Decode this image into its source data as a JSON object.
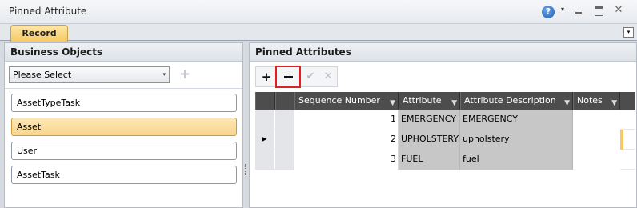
{
  "window": {
    "title": "Pinned Attribute",
    "help_glyph": "?",
    "help_caret": "▾",
    "close_glyph": "✕"
  },
  "tabs": [
    {
      "label": "Record",
      "active": true
    }
  ],
  "tab_menu_glyph": "▾",
  "left_panel": {
    "title": "Business Objects",
    "select": {
      "value": "Please Select",
      "arrow": "▾"
    },
    "add_glyph": "+",
    "items": [
      {
        "label": "AssetTypeTask",
        "selected": false
      },
      {
        "label": "Asset",
        "selected": true
      },
      {
        "label": "User",
        "selected": false
      },
      {
        "label": "AssetTask",
        "selected": false
      }
    ]
  },
  "right_panel": {
    "title": "Pinned Attributes",
    "toolbar": {
      "add": "+",
      "accept": "✔",
      "cancel": "✕"
    },
    "grid": {
      "columns": [
        "Sequence Number",
        "Attribute",
        "Attribute Description",
        "Notes"
      ],
      "filter_glyph": "▼",
      "current_row_glyph": "▶",
      "rows": [
        {
          "sequence": "1",
          "attribute": "EMERGENCY",
          "description": "EMERGENCY",
          "notes": "",
          "current": false
        },
        {
          "sequence": "2",
          "attribute": "UPHOLSTERY",
          "description": "upholstery",
          "notes": "",
          "current": true
        },
        {
          "sequence": "3",
          "attribute": "FUEL",
          "description": "fuel",
          "notes": "",
          "current": false
        }
      ]
    }
  },
  "colors": {
    "accent_tab": "#f7c964",
    "selected_item": "#f9d58d",
    "grid_header": "#4d4d4d",
    "highlight_border": "#e02020"
  }
}
